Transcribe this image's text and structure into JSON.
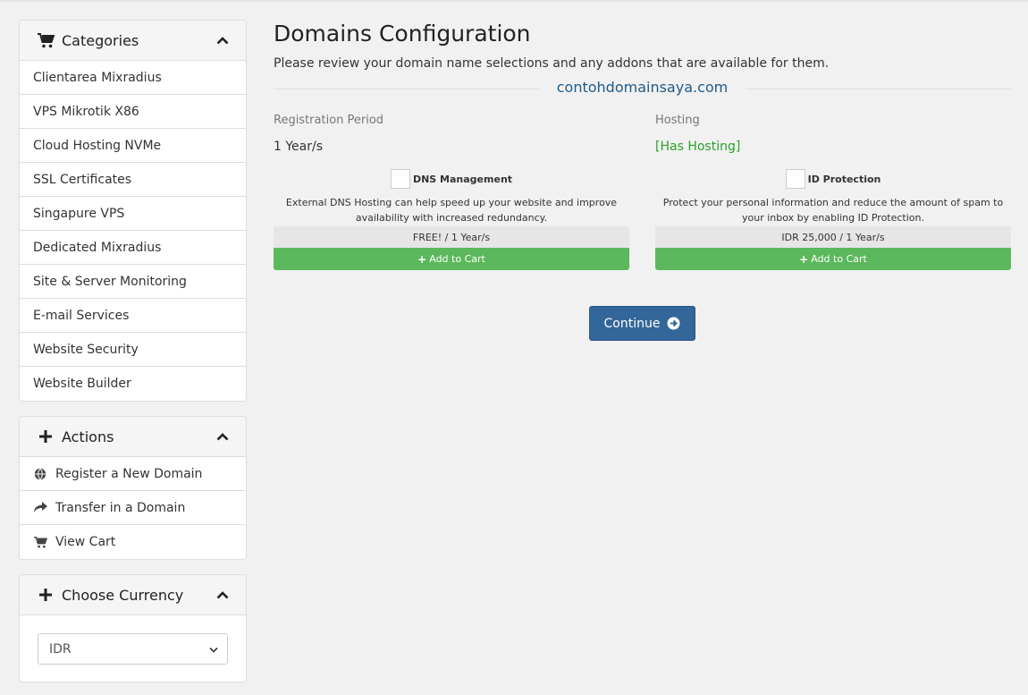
{
  "sidebar": {
    "categories": {
      "title": "Categories",
      "items": [
        {
          "label": "Clientarea Mixradius"
        },
        {
          "label": "VPS Mikrotik X86"
        },
        {
          "label": "Cloud Hosting NVMe"
        },
        {
          "label": "SSL Certificates"
        },
        {
          "label": "Singapure VPS"
        },
        {
          "label": "Dedicated Mixradius"
        },
        {
          "label": "Site & Server Monitoring"
        },
        {
          "label": "E-mail Services"
        },
        {
          "label": "Website Security"
        },
        {
          "label": "Website Builder"
        }
      ]
    },
    "actions": {
      "title": "Actions",
      "items": [
        {
          "label": "Register a New Domain",
          "icon": "globe-icon"
        },
        {
          "label": "Transfer in a Domain",
          "icon": "share-arrow-icon"
        },
        {
          "label": "View Cart",
          "icon": "cart-icon"
        }
      ]
    },
    "currency": {
      "title": "Choose Currency",
      "selected": "IDR"
    }
  },
  "main": {
    "title": "Domains Configuration",
    "subtitle": "Please review your domain name selections and any addons that are available for them.",
    "domain": "contohdomainsaya.com",
    "registration": {
      "label": "Registration Period",
      "value": "1 Year/s"
    },
    "hosting": {
      "label": "Hosting",
      "value": "[Has Hosting]"
    },
    "addons": [
      {
        "name": "DNS Management",
        "description": "External DNS Hosting can help speed up your website and improve availability with increased redundancy.",
        "price": "FREE! / 1 Year/s",
        "button": "Add to Cart"
      },
      {
        "name": "ID Protection",
        "description": "Protect your personal information and reduce the amount of spam to your inbox by enabling ID Protection.",
        "price": "IDR 25,000 / 1 Year/s",
        "button": "Add to Cart"
      }
    ],
    "continue_label": "Continue"
  },
  "colors": {
    "accent": "#336699",
    "success": "#5cb85c",
    "link": "#1f5b88",
    "hosting_green": "#2aa02a"
  }
}
